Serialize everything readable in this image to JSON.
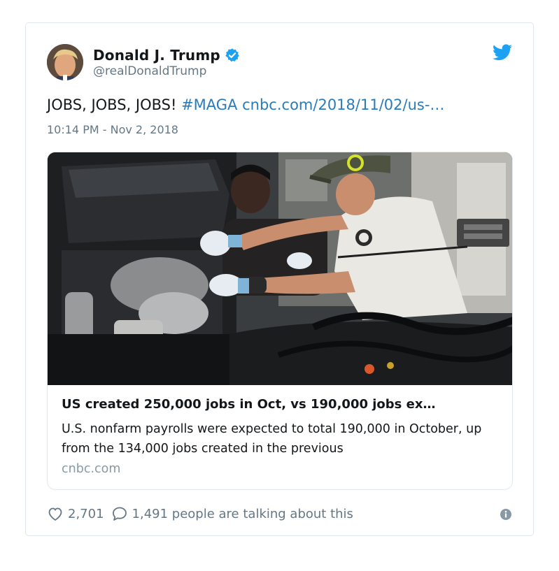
{
  "author": {
    "display_name": "Donald J. Trump",
    "handle": "@realDonaldTrump",
    "verified": true
  },
  "tweet": {
    "text_plain": "JOBS, JOBS, JOBS! ",
    "hashtag": "#MAGA",
    "url": "cnbc.com/2018/11/02/us-…",
    "timestamp": "10:14 PM - Nov 2, 2018"
  },
  "card": {
    "title": "US created 250,000 jobs in Oct, vs 190,000 jobs ex…",
    "description": "U.S. nonfarm payrolls were expected to total 190,000 in October, up from the 134,000 jobs created in the previous",
    "domain": "cnbc.com"
  },
  "actions": {
    "likes": "2,701",
    "talking": "1,491 people are talking about this"
  },
  "colors": {
    "twitter_blue": "#1da1f2",
    "link": "#2b7bb9",
    "secondary_text": "#657786"
  },
  "icons": {
    "verified": "verified-badge-icon",
    "bird": "twitter-bird-icon",
    "like": "heart-icon",
    "reply": "speech-bubble-icon",
    "info": "info-icon"
  }
}
